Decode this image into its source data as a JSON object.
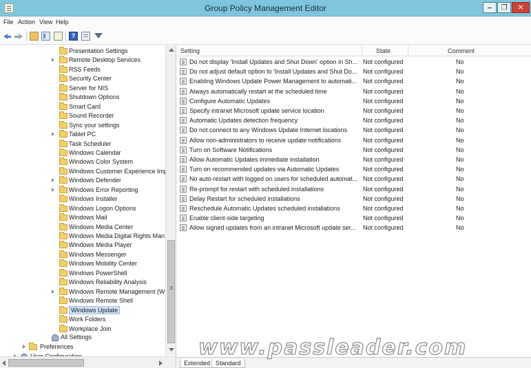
{
  "window": {
    "title": "Group Policy Management Editor",
    "min_glyph": "‒",
    "max_glyph": "❐",
    "close_glyph": "✕"
  },
  "menu": [
    "File",
    "Action",
    "View",
    "Help"
  ],
  "toolbar": {
    "help_glyph": "?"
  },
  "tree": {
    "items": [
      {
        "label": "Presentation Settings",
        "expandable": false
      },
      {
        "label": "Remote Desktop Services",
        "expandable": true
      },
      {
        "label": "RSS Feeds",
        "expandable": false
      },
      {
        "label": "Security Center",
        "expandable": false
      },
      {
        "label": "Server for NIS",
        "expandable": false
      },
      {
        "label": "Shutdown Options",
        "expandable": false
      },
      {
        "label": "Smart Card",
        "expandable": false
      },
      {
        "label": "Sound Recorder",
        "expandable": false
      },
      {
        "label": "Sync your settings",
        "expandable": false
      },
      {
        "label": "Tablet PC",
        "expandable": true
      },
      {
        "label": "Task Scheduler",
        "expandable": false
      },
      {
        "label": "Windows Calendar",
        "expandable": false
      },
      {
        "label": "Windows Color System",
        "expandable": false
      },
      {
        "label": "Windows Customer Experience Imp",
        "expandable": false
      },
      {
        "label": "Windows Defender",
        "expandable": true
      },
      {
        "label": "Windows Error Reporting",
        "expandable": true
      },
      {
        "label": "Windows Installer",
        "expandable": false
      },
      {
        "label": "Windows Logon Options",
        "expandable": false
      },
      {
        "label": "Windows Mail",
        "expandable": false
      },
      {
        "label": "Windows Media Center",
        "expandable": false
      },
      {
        "label": "Windows Media Digital Rights Man",
        "expandable": false
      },
      {
        "label": "Windows Media Player",
        "expandable": false
      },
      {
        "label": "Windows Messenger",
        "expandable": false
      },
      {
        "label": "Windows Mobility Center",
        "expandable": false
      },
      {
        "label": "Windows PowerShell",
        "expandable": false
      },
      {
        "label": "Windows Reliability Analysis",
        "expandable": false
      },
      {
        "label": "Windows Remote Management (Wi",
        "expandable": true
      },
      {
        "label": "Windows Remote Shell",
        "expandable": false
      },
      {
        "label": "Windows Update",
        "expandable": false,
        "selected": true
      },
      {
        "label": "Work Folders",
        "expandable": false
      },
      {
        "label": "Workplace Join",
        "expandable": false
      }
    ],
    "all_settings": "All Settings",
    "preferences": "Preferences",
    "user_configuration": "User Configuration"
  },
  "list": {
    "columns": {
      "setting": "Setting",
      "state": "State",
      "comment": "Comment"
    },
    "rows": [
      {
        "setting": "Do not display 'Install Updates and Shut Down' option in Sh...",
        "state": "Not configured",
        "comment": "No"
      },
      {
        "setting": "Do not adjust default option to 'Install Updates and Shut Do...",
        "state": "Not configured",
        "comment": "No"
      },
      {
        "setting": "Enabling Windows Update Power Management to automati...",
        "state": "Not configured",
        "comment": "No"
      },
      {
        "setting": "Always automatically restart at the scheduled time",
        "state": "Not configured",
        "comment": "No"
      },
      {
        "setting": "Configure Automatic Updates",
        "state": "Not configured",
        "comment": "No"
      },
      {
        "setting": "Specify intranet Microsoft update service location",
        "state": "Not configured",
        "comment": "No"
      },
      {
        "setting": "Automatic Updates detection frequency",
        "state": "Not configured",
        "comment": "No"
      },
      {
        "setting": "Do not connect to any Windows Update Internet locations",
        "state": "Not configured",
        "comment": "No"
      },
      {
        "setting": "Allow non-administrators to receive update notifications",
        "state": "Not configured",
        "comment": "No"
      },
      {
        "setting": "Turn on Software Notifications",
        "state": "Not configured",
        "comment": "No"
      },
      {
        "setting": "Allow Automatic Updates immediate installation",
        "state": "Not configured",
        "comment": "No"
      },
      {
        "setting": "Turn on recommended updates via Automatic Updates",
        "state": "Not configured",
        "comment": "No"
      },
      {
        "setting": "No auto-restart with logged on users for scheduled automat...",
        "state": "Not configured",
        "comment": "No"
      },
      {
        "setting": "Re-prompt for restart with scheduled installations",
        "state": "Not configured",
        "comment": "No"
      },
      {
        "setting": "Delay Restart for scheduled installations",
        "state": "Not configured",
        "comment": "No"
      },
      {
        "setting": "Reschedule Automatic Updates scheduled installations",
        "state": "Not configured",
        "comment": "No"
      },
      {
        "setting": "Enable client-side targeting",
        "state": "Not configured",
        "comment": "No"
      },
      {
        "setting": "Allow signed updates from an intranet Microsoft update ser...",
        "state": "Not configured",
        "comment": "No"
      }
    ]
  },
  "tabs": {
    "extended": "Extended",
    "standard": "Standard"
  },
  "watermark": "www.passleader.com"
}
